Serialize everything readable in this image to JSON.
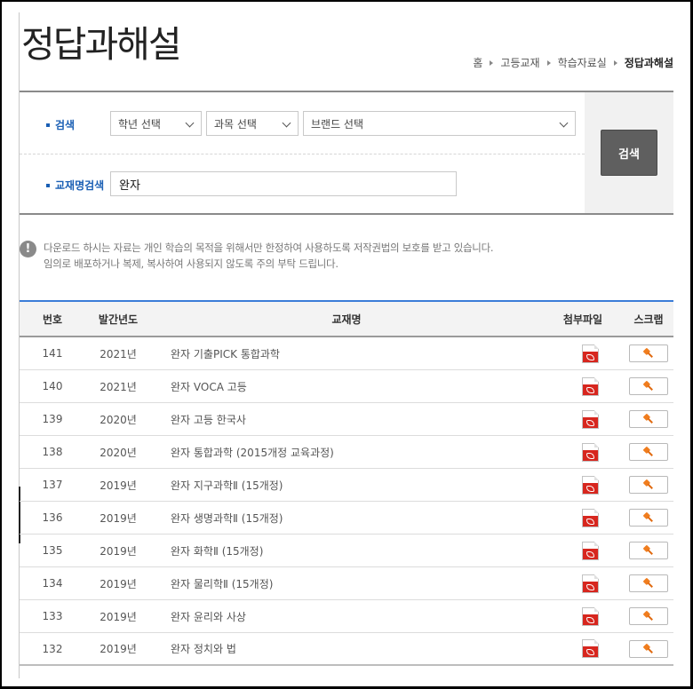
{
  "page": {
    "title": "정답과해설"
  },
  "breadcrumb": [
    "홈",
    "고등교재",
    "학습자료실",
    "정답과해설"
  ],
  "search": {
    "label": "검색",
    "grade_select": "학년 선택",
    "subject_select": "과목 선택",
    "brand_select": "브랜드 선택",
    "name_label": "교재명검색",
    "name_value": "완자",
    "button": "검색"
  },
  "notice": {
    "icon": "!",
    "line1": "다운로드 하시는 자료는 개인 학습의 목적을 위해서만 한정하여 사용하도록 저작권법의 보호를 받고 있습니다.",
    "line2": "임의로 배포하거나 복제, 복사하여 사용되지 않도록 주의 부탁 드립니다."
  },
  "table": {
    "headers": {
      "no": "번호",
      "year": "발간년도",
      "name": "교재명",
      "file": "첨부파일",
      "scrap": "스크랩"
    },
    "rows": [
      {
        "no": "141",
        "year": "2021년",
        "name": "완자 기출PICK 통합과학"
      },
      {
        "no": "140",
        "year": "2021년",
        "name": "완자 VOCA 고등"
      },
      {
        "no": "139",
        "year": "2020년",
        "name": "완자 고등 한국사"
      },
      {
        "no": "138",
        "year": "2020년",
        "name": "완자 통합과학 (2015개정 교육과정)"
      },
      {
        "no": "137",
        "year": "2019년",
        "name": "완자 지구과학Ⅱ (15개정)"
      },
      {
        "no": "136",
        "year": "2019년",
        "name": "완자 생명과학Ⅱ (15개정)"
      },
      {
        "no": "135",
        "year": "2019년",
        "name": "완자 화학Ⅱ (15개정)"
      },
      {
        "no": "134",
        "year": "2019년",
        "name": "완자 물리학Ⅱ (15개정)"
      },
      {
        "no": "133",
        "year": "2019년",
        "name": "완자 윤리와 사상"
      },
      {
        "no": "132",
        "year": "2019년",
        "name": "완자 정치와 법"
      }
    ]
  },
  "icons": {
    "file": "pdf-icon",
    "scrap": "pin-icon",
    "info": "info-icon",
    "select": "chevron-down-icon"
  },
  "colors": {
    "accent": "#1a5fb4",
    "table_top_border": "#3b7dd8",
    "pdf": "#d7261e",
    "pin": "#f07d1e",
    "search_button": "#5f5f5f"
  }
}
